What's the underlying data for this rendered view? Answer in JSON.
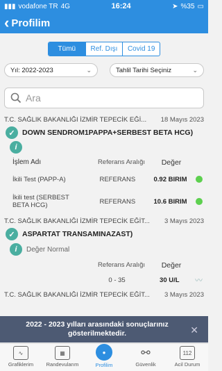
{
  "status": {
    "carrier": "vodafone TR",
    "network": "4G",
    "time": "16:24",
    "battery": "%35"
  },
  "nav": {
    "back": "Profilim"
  },
  "segments": [
    {
      "label": "Tümü",
      "active": true
    },
    {
      "label": "Ref. Dışı",
      "active": false
    },
    {
      "label": "Covid 19",
      "active": false
    }
  ],
  "filters": {
    "year": "Yıl: 2022-2023",
    "date": "Tahlil Tarihi Seçiniz"
  },
  "search": {
    "placeholder": "Ara"
  },
  "results": [
    {
      "hospital": "T.C. SAĞLIK BAKANLIĞI İZMİR TEPECİK EĞİ...",
      "date": "18 Mayıs 2023",
      "title": "DOWN SENDROM1PAPPA+SERBEST BETA HCG)"
    },
    {
      "hospital": "T.C. SAĞLIK BAKANLIĞI İZMİR TEPECİK EĞİT...",
      "date": "3 Mayıs 2023",
      "title": "ASPARTAT TRANSAMINAZAST)",
      "info": "Değer Normal"
    },
    {
      "hospital": "T.C. SAĞLIK BAKANLIĞI İZMİR TEPECİK EĞİT...",
      "date": "3 Mayıs 2023"
    }
  ],
  "table1": {
    "headers": {
      "name": "İşlem Adı",
      "ref": "Referans Aralığı",
      "value": "Değer"
    },
    "rows": [
      {
        "name": "İkili Test (PAPP-A)",
        "ref": "REFERANS",
        "value": "0.92 BIRIM"
      },
      {
        "name": "İkili test (SERBEST BETA HCG)",
        "ref": "REFERANS",
        "value": "10.6 BIRIM"
      }
    ]
  },
  "table2": {
    "headers": {
      "ref": "Referans Aralığı",
      "value": "Değer"
    },
    "rows": [
      {
        "ref": "0 - 35",
        "value": "30 U/L"
      }
    ]
  },
  "toast": {
    "message": "2022 - 2023 yılları arasındaki sonuçlarınız gösterilmektedir."
  },
  "tabs": [
    {
      "label": "Grafiklerim",
      "icon": "chart-icon"
    },
    {
      "label": "Randevularım",
      "icon": "calendar-icon"
    },
    {
      "label": "Profilim",
      "icon": "profile-icon",
      "active": true
    },
    {
      "label": "Güvenlik",
      "icon": "link-icon"
    },
    {
      "label": "Acil Durum",
      "icon": "emergency-112-icon",
      "glyph": "112"
    }
  ],
  "colors": {
    "primary": "#2d8ee0",
    "success": "#5dd04f",
    "teal": "#4aaea0",
    "toast": "#4d5a73"
  }
}
